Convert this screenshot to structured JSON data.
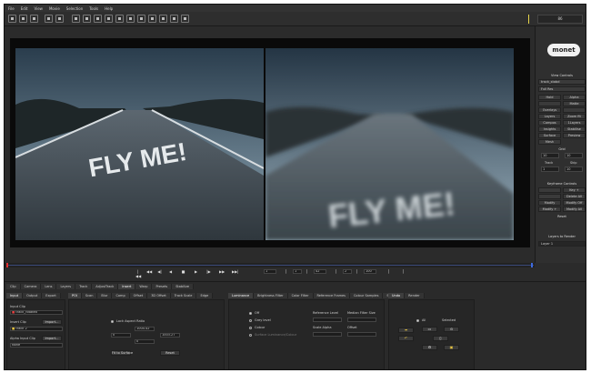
{
  "menu": [
    "File",
    "Edit",
    "View",
    "Movie",
    "Selection",
    "Tools",
    "Help"
  ],
  "toolbar": {
    "icons": [
      "new-file-icon",
      "open-folder-icon",
      "save-icon",
      "undo-icon",
      "redo-icon",
      "pointer-icon",
      "transform-icon",
      "hand-icon",
      "zoom-icon",
      "lasso-icon",
      "rectangle-select-icon",
      "polygon-select-icon",
      "pin-icon",
      "brush-icon",
      "magic-wand-icon",
      "crop-icon"
    ],
    "frame_box": "86"
  },
  "logo": {
    "text": "monet"
  },
  "viewer": {
    "left_text": "FLY ME!",
    "right_text": "FLY ME!"
  },
  "right_panel": {
    "view_controls": "View Controls",
    "clip_select": "track_stabd",
    "mode_select": "Full Res",
    "buttons_a": [
      [
        "Hold",
        "Alpha"
      ],
      [
        "",
        "Matte"
      ],
      [
        "Overlays",
        ""
      ],
      [
        "Layers",
        "Zoom fit"
      ],
      [
        "Compos",
        "1Layers"
      ],
      [
        "Insights",
        "Stabilise"
      ],
      [
        "Surface",
        "Preview"
      ],
      [
        "Mesh",
        ""
      ]
    ],
    "grid_label": "Grid",
    "grid_x": "10",
    "grid_y": "10",
    "track_labels": [
      "Track",
      "Skip"
    ],
    "track_values": [
      "1",
      "10"
    ],
    "keyframe_controls": "Keyframe Controls",
    "buttons_b": [
      [
        "",
        "Key +"
      ],
      [
        "",
        "Delete All"
      ],
      [
        "Modify",
        "Modify Off"
      ],
      [
        "Modify +",
        "Modify All"
      ]
    ],
    "reset": "Reset",
    "layers_to_render": "Layers to Render",
    "layer_item": "Layer 1"
  },
  "transport": {
    "buttons": [
      "|◀◀",
      "◀◀",
      "◀|",
      "◀",
      "■",
      "▶",
      "|▶",
      "▶▶",
      "▶▶|"
    ],
    "fields": [
      "1",
      "[",
      "1",
      "]",
      "42",
      "[",
      "2",
      "]",
      "100"
    ]
  },
  "bottom": {
    "tabs_main": [
      "Clip",
      "Camera",
      "Lens",
      "Layers",
      "Track",
      "AdjustTrack",
      "Insert",
      "Warp",
      "Presets",
      "Stabilize"
    ],
    "tabs_sub": [
      "Input",
      "Output",
      "Export"
    ],
    "tabs_tools": [
      "POI",
      "Scan",
      "Blur",
      "Comp",
      "Offset",
      "3D Offset",
      "Track Scale",
      "Edge"
    ],
    "tabs_filters": [
      "Luminance",
      "Brightness Filter",
      "Color Filter",
      "Reference Frames",
      "Colour Samples",
      "Size"
    ],
    "tabs_render": [
      "Undo",
      "Render"
    ],
    "input_clip_label": "Input Clip",
    "input_clip": "track_rotated",
    "insert_clip_label": "Insert Clip",
    "import_label": "Import...",
    "insert_clip": "track 2",
    "alpha_clip_label": "Alpha Input Clip",
    "alpha_clip": "None",
    "lock_aspect": "Lock Aspect Ratio",
    "width_value": "1004.42",
    "height_value": "1003.27",
    "x_value": "0",
    "y_value": "0",
    "fit_to_surface": "Fit to Surface",
    "reset": "Reset",
    "radio_options": [
      "Off",
      "Grey level",
      "Colour",
      "Surface Luminance/Colour"
    ],
    "ref_level_label": "Reference Level",
    "median_filter_label": "Median Filter Size",
    "scale_alpha_label": "Scale Alpha",
    "offset_label": "Offset",
    "render_all": "All",
    "render_selected": "Selected"
  }
}
